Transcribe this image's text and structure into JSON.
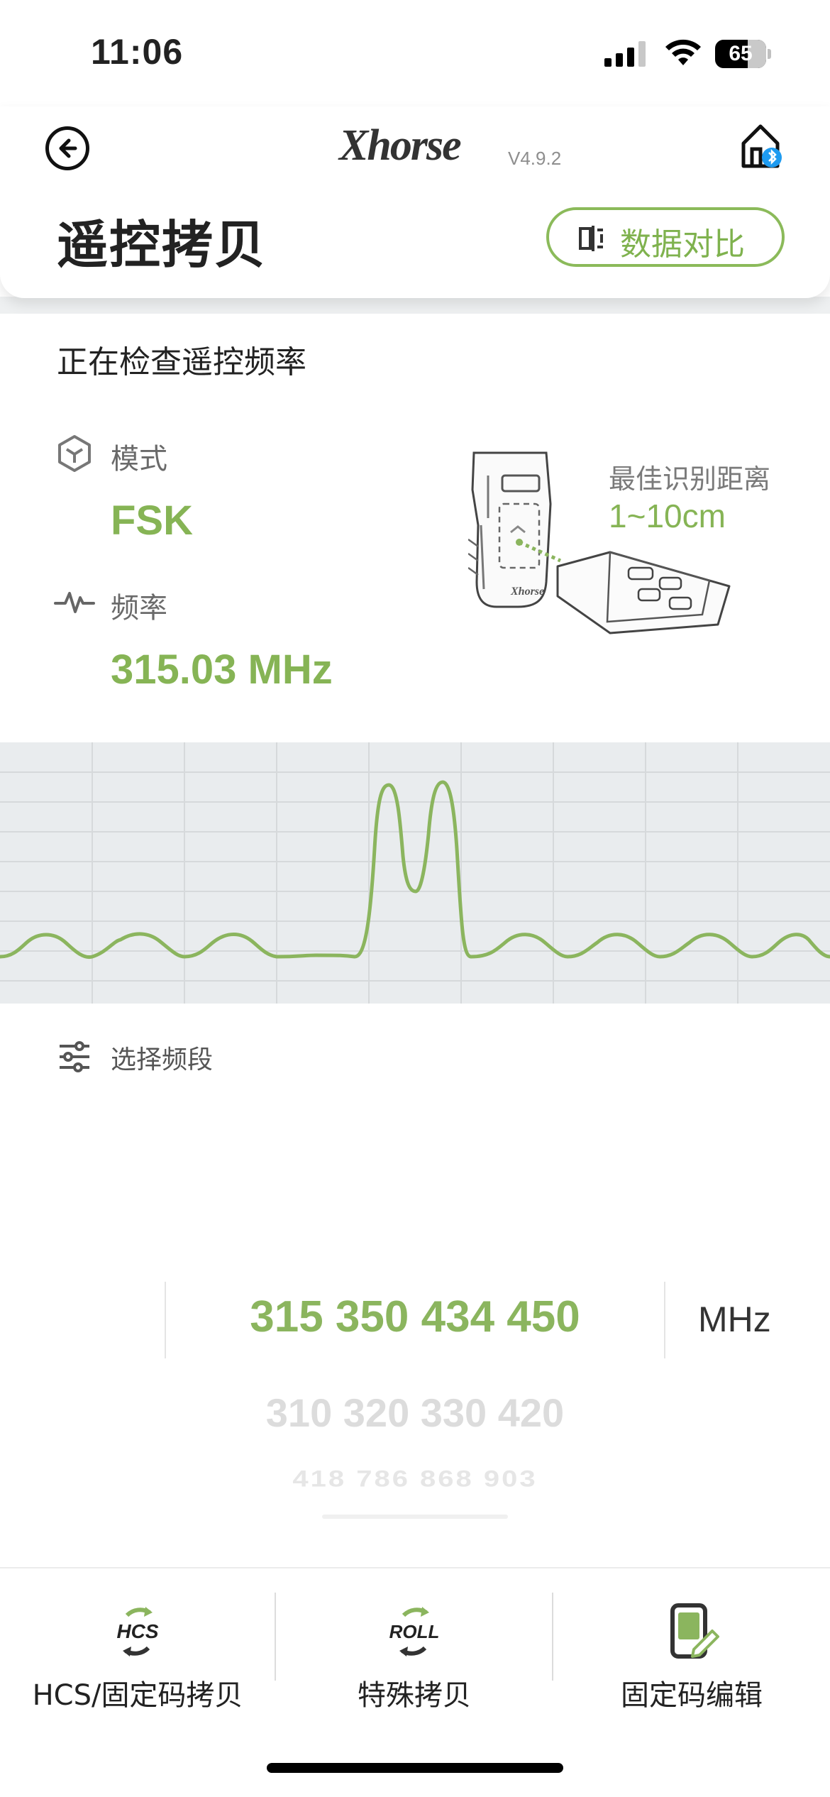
{
  "status_bar": {
    "time": "11:06",
    "battery": "65"
  },
  "header": {
    "logo": "Xhorse",
    "version": "V4.9.2",
    "title": "遥控拷贝",
    "compare_button": "数据对比"
  },
  "detection": {
    "status": "正在检查遥控频率",
    "mode_label": "模式",
    "mode_value": "FSK",
    "freq_label": "频率",
    "freq_value": "315.03 MHz",
    "distance_label": "最佳识别距离",
    "distance_value": "1~10cm"
  },
  "band_selector": {
    "label": "选择频段",
    "selected": "315 350 434 450",
    "unit": "MHz",
    "next_row": "310 320 330 420",
    "third_row": "418 786 868 903"
  },
  "tabs": [
    {
      "label": "HCS/固定码拷贝",
      "icon": "hcs-icon"
    },
    {
      "label": "特殊拷贝",
      "icon": "roll-icon"
    },
    {
      "label": "固定码编辑",
      "icon": "edit-phone-icon"
    }
  ],
  "colors": {
    "accent": "#86b455",
    "wave_bg": "#e9ecee"
  }
}
